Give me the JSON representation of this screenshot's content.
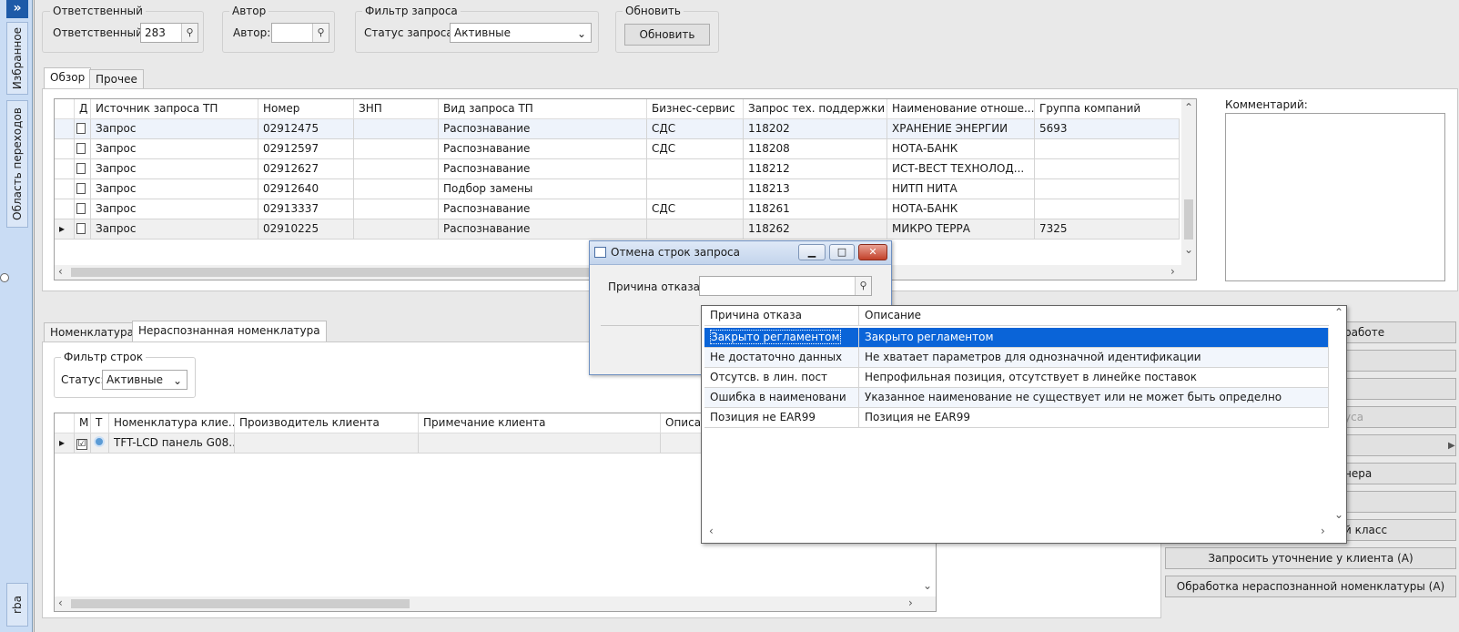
{
  "sidebar": {
    "expand": "»",
    "tabs": [
      "Избранное",
      "Область переходов",
      "rba"
    ]
  },
  "filters": {
    "responsible": {
      "group": "Ответственный",
      "label": "Ответственный:",
      "value": "283"
    },
    "author": {
      "group": "Автор",
      "label": "Автор:",
      "value": ""
    },
    "request_filter": {
      "group": "Фильтр запроса",
      "label": "Статус запроса:",
      "value": "Активные"
    },
    "refresh": {
      "group": "Обновить",
      "button": "Обновить"
    }
  },
  "top_tabs": [
    "Обзор",
    "Прочее"
  ],
  "requests_grid": {
    "columns": [
      "Д",
      "Источник запроса ТП",
      "Номер",
      "ЗНП",
      "Вид запроса ТП",
      "Бизнес-сервис",
      "Запрос тех. поддержки",
      "Наименование отноше...",
      "Группа компаний"
    ],
    "rows": [
      [
        "",
        "Запрос",
        "02912475",
        "",
        "Распознавание",
        "СДС",
        "118202",
        "ХРАНЕНИЕ ЭНЕРГИИ",
        "5693"
      ],
      [
        "",
        "Запрос",
        "02912597",
        "",
        "Распознавание",
        "СДС",
        "118208",
        "НОТА-БАНК",
        ""
      ],
      [
        "",
        "Запрос",
        "02912627",
        "",
        "Распознавание",
        "",
        "118212",
        "ИСТ-ВЕСТ ТЕХНОЛОД...",
        ""
      ],
      [
        "",
        "Запрос",
        "02912640",
        "",
        "Подбор замены",
        "",
        "118213",
        "НИТП НИТА",
        ""
      ],
      [
        "",
        "Запрос",
        "02913337",
        "",
        "Распознавание",
        "СДС",
        "118261",
        "НОТА-БАНК",
        ""
      ],
      [
        "",
        "Запрос",
        "02910225",
        "",
        "Распознавание",
        "",
        "118262",
        "МИКРО ТЕРРА",
        "7325"
      ]
    ]
  },
  "comment": {
    "label": "Комментарий:",
    "value": ""
  },
  "bottom_tabs": [
    "Номенклатура",
    "Нераспознанная номенклатура"
  ],
  "row_filter": {
    "group": "Фильтр строк",
    "label": "Статус:",
    "value": "Активные"
  },
  "nomenclature_grid": {
    "columns": [
      "М",
      "Т",
      "Номенклатура клие...",
      "Производитель клиента",
      "Примечание клиента",
      "Описа"
    ],
    "rows": [
      [
        "☑",
        "",
        "TFT-LCD панель G08...",
        "",
        "",
        ""
      ]
    ]
  },
  "right_buttons": [
    {
      "label": "работе",
      "disabled": false
    },
    {
      "label": "",
      "disabled": false
    },
    {
      "label": "",
      "disabled": true
    },
    {
      "label": "уса",
      "disabled": true
    },
    {
      "label": "",
      "disabled": false
    },
    {
      "label": "нера",
      "disabled": false
    },
    {
      "label": "",
      "disabled": false
    },
    {
      "label": "й класс",
      "disabled": false
    },
    {
      "label": "Запросить уточнение у клиента (А)",
      "disabled": false
    },
    {
      "label": "Обработка нераспознанной номенклатуры (А)",
      "disabled": false
    }
  ],
  "dialog": {
    "title": "Отмена строк запроса",
    "reason_label": "Причина отказа:",
    "reason_value": ""
  },
  "reason_popup": {
    "columns": [
      "Причина отказа",
      "Описание"
    ],
    "rows": [
      [
        "Закрыто регламентом",
        "Закрыто регламентом"
      ],
      [
        "Не достаточно данных",
        "Не хватает параметров для однозначной идентификации"
      ],
      [
        "Отсутсв. в лин. пост",
        "Непрофильная позиция, отсутствует в линейке поставок"
      ],
      [
        "Ошибка в наименовани",
        "Указанное наименование не существует или не может быть определно"
      ],
      [
        "Позиция не EAR99",
        "Позиция не EAR99"
      ]
    ],
    "selected_index": 0
  },
  "colors": {
    "selection": "#0a64d8",
    "sidebar": "#c9dcf4"
  }
}
